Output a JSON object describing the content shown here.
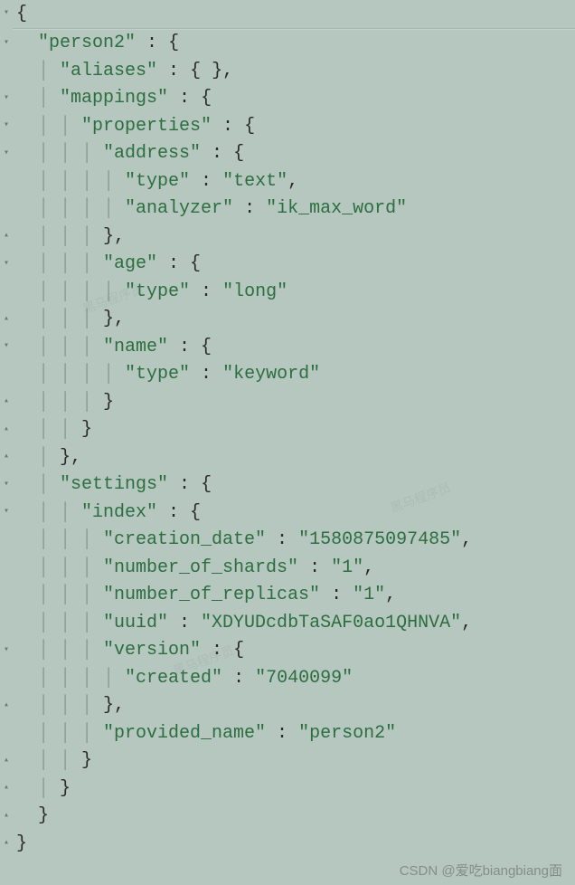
{
  "gutter": [
    "▾",
    "▾",
    "",
    "▾",
    "▾",
    "▾",
    "",
    "",
    "▴",
    "▾",
    "",
    "▴",
    "▾",
    "",
    "▴",
    "▴",
    "▴",
    "▾",
    "▾",
    "",
    "",
    "",
    "",
    "▾",
    "",
    "▴",
    "",
    "▴",
    "▴",
    "▴",
    "▴"
  ],
  "code_lines": [
    {
      "i": 0,
      "g": "",
      "s": [
        [
          "curl",
          "{"
        ]
      ]
    },
    {
      "i": 1,
      "g": "  ",
      "s": [
        [
          "key",
          "\"person2\""
        ],
        [
          "punct",
          " : "
        ],
        [
          "curl",
          "{"
        ]
      ]
    },
    {
      "i": 2,
      "g": "  | ",
      "s": [
        [
          "key",
          "\"aliases\""
        ],
        [
          "punct",
          " : "
        ],
        [
          "curl",
          "{ }"
        ],
        [
          "punct",
          ","
        ]
      ]
    },
    {
      "i": 3,
      "g": "  | ",
      "s": [
        [
          "key",
          "\"mappings\""
        ],
        [
          "punct",
          " : "
        ],
        [
          "curl",
          "{"
        ]
      ]
    },
    {
      "i": 4,
      "g": "  | | ",
      "s": [
        [
          "key",
          "\"properties\""
        ],
        [
          "punct",
          " : "
        ],
        [
          "curl",
          "{"
        ]
      ]
    },
    {
      "i": 5,
      "g": "  | | | ",
      "s": [
        [
          "key",
          "\"address\""
        ],
        [
          "punct",
          " : "
        ],
        [
          "curl",
          "{"
        ]
      ]
    },
    {
      "i": 6,
      "g": "  | | | | ",
      "s": [
        [
          "key",
          "\"type\""
        ],
        [
          "punct",
          " : "
        ],
        [
          "str",
          "\"text\""
        ],
        [
          "punct",
          ","
        ]
      ]
    },
    {
      "i": 7,
      "g": "  | | | | ",
      "s": [
        [
          "key",
          "\"analyzer\""
        ],
        [
          "punct",
          " : "
        ],
        [
          "str",
          "\"ik_max_word\""
        ]
      ]
    },
    {
      "i": 8,
      "g": "  | | | ",
      "s": [
        [
          "curl",
          "}"
        ],
        [
          "punct",
          ","
        ]
      ]
    },
    {
      "i": 9,
      "g": "  | | | ",
      "s": [
        [
          "key",
          "\"age\""
        ],
        [
          "punct",
          " : "
        ],
        [
          "curl",
          "{"
        ]
      ]
    },
    {
      "i": 10,
      "g": "  | | | | ",
      "s": [
        [
          "key",
          "\"type\""
        ],
        [
          "punct",
          " : "
        ],
        [
          "str",
          "\"long\""
        ]
      ]
    },
    {
      "i": 11,
      "g": "  | | | ",
      "s": [
        [
          "curl",
          "}"
        ],
        [
          "punct",
          ","
        ]
      ]
    },
    {
      "i": 12,
      "g": "  | | | ",
      "s": [
        [
          "key",
          "\"name\""
        ],
        [
          "punct",
          " : "
        ],
        [
          "curl",
          "{"
        ]
      ]
    },
    {
      "i": 13,
      "g": "  | | | | ",
      "s": [
        [
          "key",
          "\"type\""
        ],
        [
          "punct",
          " : "
        ],
        [
          "str",
          "\"keyword\""
        ]
      ]
    },
    {
      "i": 14,
      "g": "  | | | ",
      "s": [
        [
          "curl",
          "}"
        ]
      ]
    },
    {
      "i": 15,
      "g": "  | | ",
      "s": [
        [
          "curl",
          "}"
        ]
      ]
    },
    {
      "i": 16,
      "g": "  | ",
      "s": [
        [
          "curl",
          "}"
        ],
        [
          "punct",
          ","
        ]
      ]
    },
    {
      "i": 17,
      "g": "  | ",
      "s": [
        [
          "key",
          "\"settings\""
        ],
        [
          "punct",
          " : "
        ],
        [
          "curl",
          "{"
        ]
      ]
    },
    {
      "i": 18,
      "g": "  | | ",
      "s": [
        [
          "key",
          "\"index\""
        ],
        [
          "punct",
          " : "
        ],
        [
          "curl",
          "{"
        ]
      ]
    },
    {
      "i": 19,
      "g": "  | | | ",
      "s": [
        [
          "key",
          "\"creation_date\""
        ],
        [
          "punct",
          " : "
        ],
        [
          "str",
          "\"1580875097485\""
        ],
        [
          "punct",
          ","
        ]
      ]
    },
    {
      "i": 20,
      "g": "  | | | ",
      "s": [
        [
          "key",
          "\"number_of_shards\""
        ],
        [
          "punct",
          " : "
        ],
        [
          "str",
          "\"1\""
        ],
        [
          "punct",
          ","
        ]
      ]
    },
    {
      "i": 21,
      "g": "  | | | ",
      "s": [
        [
          "key",
          "\"number_of_replicas\""
        ],
        [
          "punct",
          " : "
        ],
        [
          "str",
          "\"1\""
        ],
        [
          "punct",
          ","
        ]
      ]
    },
    {
      "i": 22,
      "g": "  | | | ",
      "s": [
        [
          "key",
          "\"uuid\""
        ],
        [
          "punct",
          " : "
        ],
        [
          "str",
          "\"XDYUDcdbTaSAF0ao1QHNVA\""
        ],
        [
          "punct",
          ","
        ]
      ]
    },
    {
      "i": 23,
      "g": "  | | | ",
      "s": [
        [
          "key",
          "\"version\""
        ],
        [
          "punct",
          " : "
        ],
        [
          "curl",
          "{"
        ]
      ]
    },
    {
      "i": 24,
      "g": "  | | | | ",
      "s": [
        [
          "key",
          "\"created\""
        ],
        [
          "punct",
          " : "
        ],
        [
          "str",
          "\"7040099\""
        ]
      ]
    },
    {
      "i": 25,
      "g": "  | | | ",
      "s": [
        [
          "curl",
          "}"
        ],
        [
          "punct",
          ","
        ]
      ]
    },
    {
      "i": 26,
      "g": "  | | | ",
      "s": [
        [
          "key",
          "\"provided_name\""
        ],
        [
          "punct",
          " : "
        ],
        [
          "str",
          "\"person2\""
        ]
      ]
    },
    {
      "i": 27,
      "g": "  | | ",
      "s": [
        [
          "curl",
          "}"
        ]
      ]
    },
    {
      "i": 28,
      "g": "  | ",
      "s": [
        [
          "curl",
          "}"
        ]
      ]
    },
    {
      "i": 29,
      "g": "  ",
      "s": [
        [
          "curl",
          "}"
        ]
      ]
    },
    {
      "i": 30,
      "g": "",
      "s": [
        [
          "curl",
          "}"
        ]
      ]
    }
  ],
  "watermark_text": "CSDN @爱吃biangbiang面",
  "json_value": {
    "person2": {
      "aliases": {},
      "mappings": {
        "properties": {
          "address": {
            "type": "text",
            "analyzer": "ik_max_word"
          },
          "age": {
            "type": "long"
          },
          "name": {
            "type": "keyword"
          }
        }
      },
      "settings": {
        "index": {
          "creation_date": "1580875097485",
          "number_of_shards": "1",
          "number_of_replicas": "1",
          "uuid": "XDYUDcdbTaSAF0ao1QHNVA",
          "version": {
            "created": "7040099"
          },
          "provided_name": "person2"
        }
      }
    }
  }
}
